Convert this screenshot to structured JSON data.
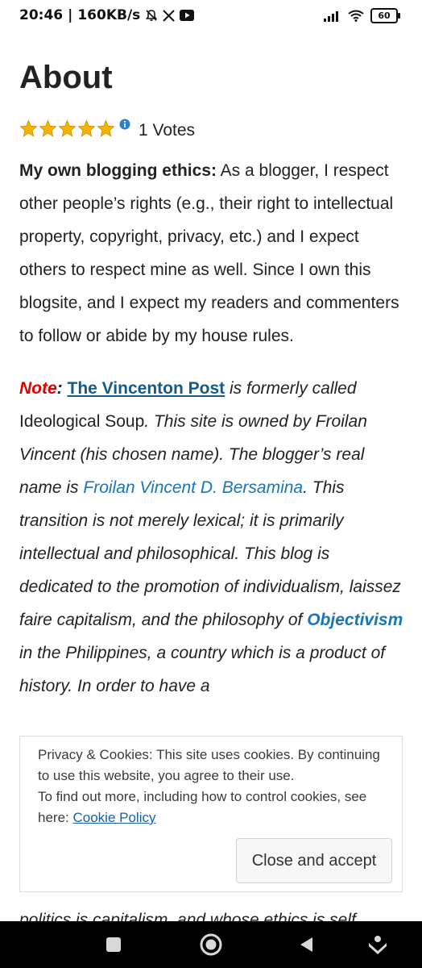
{
  "status_bar": {
    "time": "20:46",
    "separator": "|",
    "speed": "160KB/s",
    "battery": "60",
    "icons": [
      "bell-off-icon",
      "x-logo-icon",
      "youtube-icon",
      "signal-icon",
      "wifi-icon",
      "battery-icon"
    ]
  },
  "page": {
    "title": "About",
    "rating": {
      "stars": 5,
      "max": 5,
      "votes_label": "1 Votes",
      "star_color": "#f5b301"
    },
    "ethics": {
      "label": "My own blogging ethics:",
      "text": " As a blogger, I respect other people’s rights (e.g., their right to intellectual property, copyright, privacy, etc.) and I expect others to respect mine as well. Since I own this blogsite, and I expect my readers and commenters to follow or abide by my house rules."
    },
    "note": {
      "label": "Note",
      "colon": ":",
      "link_text": "The Vincenton Post",
      "t1": " is formerly called ",
      "former_name": "Ideological Soup",
      "t2": ". This site is owned by Froilan Vincent (his chosen name). The blogger’s real name is ",
      "real_name_link": "Froilan Vincent D. Bersamina",
      "t3": ". This transition is not merely lexical; it is primarily intellectual and philosophical. This blog is dedicated to the promotion of individualism, laissez faire capitalism, and the philosophy of ",
      "objectivism_link": "Objectivism",
      "t4": " in the Philippines, a country which is a product of history. In order to have a"
    },
    "underlay_text": "politics is capitalism, and whose ethics is self"
  },
  "cookie_banner": {
    "line1": "Privacy & Cookies: This site uses cookies. By continuing to use this website, you agree to their use.",
    "line2": "To find out more, including how to control cookies, see here: ",
    "policy_link": "Cookie Policy",
    "button": "Close and accept"
  },
  "nav_bar": {
    "buttons": [
      "recents-square-icon",
      "home-circle-icon",
      "back-triangle-icon",
      "assistant-icon"
    ]
  },
  "colors": {
    "note_red": "#e00000",
    "link_blue": "#1a75b8",
    "title_link_blue": "#145a8a",
    "nav_bg": "#000000"
  }
}
